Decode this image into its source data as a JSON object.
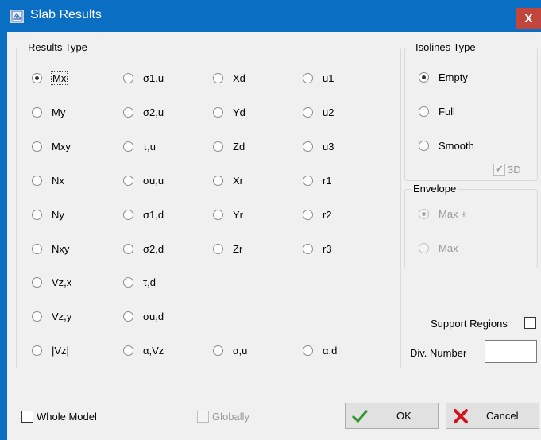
{
  "window": {
    "title": "Slab Results",
    "close_glyph": "x",
    "accent": "#0a6fc2",
    "close_color": "#c1453b"
  },
  "results_type": {
    "label": "Results Type",
    "col1": [
      "Mx",
      "My",
      "Mxy",
      "Nx",
      "Ny",
      "Nxy",
      "Vz,x",
      "Vz,y",
      "|Vz|"
    ],
    "col2": [
      "σ1,u",
      "σ2,u",
      "τ,u",
      "σu,u",
      "σ1,d",
      "σ2,d",
      "τ,d",
      "σu,d",
      "α,Vz"
    ],
    "col3": [
      "Xd",
      "Yd",
      "Zd",
      "Xr",
      "Yr",
      "Zr",
      "α,u"
    ],
    "col4": [
      "u1",
      "u2",
      "u3",
      "r1",
      "r2",
      "r3",
      "α,d"
    ],
    "selected": "Mx"
  },
  "isolines": {
    "label": "Isolines Type",
    "options": [
      "Empty",
      "Full",
      "Smooth"
    ],
    "selected": "Empty",
    "three_d_label": "3D"
  },
  "envelope": {
    "label": "Envelope",
    "options": [
      "Max +",
      "Max -"
    ],
    "selected": "Max +"
  },
  "support_regions_label": "Support Regions",
  "div_number_label": "Div. Number",
  "div_number_value": "",
  "whole_model_label": "Whole Model",
  "globally_label": "Globally",
  "ok_label": "OK",
  "cancel_label": "Cancel"
}
